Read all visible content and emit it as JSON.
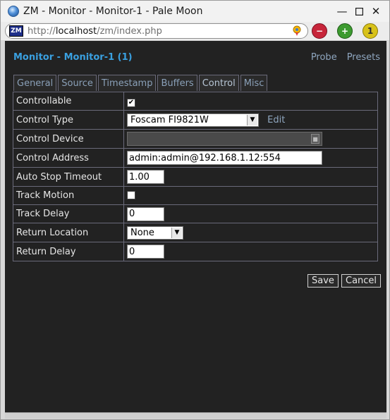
{
  "window": {
    "title": "ZM - Monitor - Monitor-1 - Pale Moon"
  },
  "browser": {
    "url_prefix": "http://",
    "url_host": "localhost",
    "url_path": "/zm/index.php",
    "site_icon_label": "ZM"
  },
  "page": {
    "title": "Monitor - Monitor-1 (1)",
    "links": [
      "Probe",
      "Presets"
    ]
  },
  "tabs": [
    {
      "label": "General",
      "active": false
    },
    {
      "label": "Source",
      "active": false
    },
    {
      "label": "Timestamp",
      "active": false
    },
    {
      "label": "Buffers",
      "active": false
    },
    {
      "label": "Control",
      "active": true
    },
    {
      "label": "Misc",
      "active": false
    }
  ],
  "form": {
    "controllable": {
      "label": "Controllable",
      "checked": true
    },
    "control_type": {
      "label": "Control Type",
      "value": "Foscam FI9821W",
      "edit_label": "Edit"
    },
    "control_device": {
      "label": "Control Device",
      "value": ""
    },
    "control_address": {
      "label": "Control Address",
      "value": "admin:admin@192.168.1.12:554"
    },
    "auto_stop_timeout": {
      "label": "Auto Stop Timeout",
      "value": "1.00"
    },
    "track_motion": {
      "label": "Track Motion",
      "checked": false
    },
    "track_delay": {
      "label": "Track Delay",
      "value": "0"
    },
    "return_location": {
      "label": "Return Location",
      "value": "None"
    },
    "return_delay": {
      "label": "Return Delay",
      "value": "0"
    }
  },
  "buttons": {
    "save": "Save",
    "cancel": "Cancel"
  },
  "colors": {
    "accent": "#3aa0e0",
    "link": "#8fa6bf",
    "background": "#222222"
  }
}
